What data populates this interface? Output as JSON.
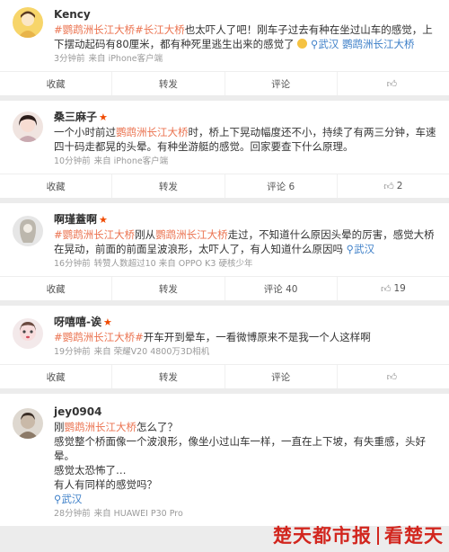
{
  "posts": [
    {
      "user": "Kency",
      "verified": false,
      "body_tags": [
        "#鹦鹉洲长江大桥",
        "#长江大桥"
      ],
      "body_text": "也太吓人了吧！刚车子过去有种在坐过山车的感觉，上下摆动起码有80厘米，都有种死里逃生出来的感觉了",
      "location": "武汉",
      "location_tag": "鹦鹉洲长江大桥",
      "time": "3分钟前",
      "source": "来自 iPhone客户端",
      "actions": {
        "fav": "收藏",
        "repost": "转发",
        "comment": "评论",
        "like": ""
      }
    },
    {
      "user": "桑三麻子",
      "verified": true,
      "body_pre": "一个小时前过",
      "body_tag": "鹦鹉洲长江大桥",
      "body_text": "时，桥上下晃动幅度还不小，持续了有两三分钟，车速四十码走都晃的头晕。有种坐游艇的感觉。回家要查下什么原理。",
      "time": "10分钟前",
      "source": "来自 iPhone客户端",
      "actions": {
        "fav": "收藏",
        "repost": "转发",
        "comment": "评论 6",
        "like": "2"
      }
    },
    {
      "user": "啊瑾蓋啊",
      "verified": true,
      "body_tag1": "#鹦鹉洲长江大桥",
      "body_mid": "刚从",
      "body_tag2": "鹦鹉洲长江大桥",
      "body_text": "走过，不知道什么原因头晕的厉害，感觉大桥在晃动，前面的前面呈波浪形，太吓人了，有人知道什么原因吗",
      "location": "武汉",
      "time": "16分钟前",
      "source": "转赞人数超过10  来自 OPPO K3 硬核少年",
      "actions": {
        "fav": "收藏",
        "repost": "转发",
        "comment": "评论 40",
        "like": "19"
      }
    },
    {
      "user": "呀嘻嘻-诶",
      "verified": true,
      "body_tag": "#鹦鹉洲长江大桥#",
      "body_text": "开车开到晕车，一看微博原来不是我一个人这样啊",
      "time": "19分钟前",
      "source": "来自 荣耀V20 4800万3D相机",
      "actions": {
        "fav": "收藏",
        "repost": "转发",
        "comment": "评论",
        "like": ""
      }
    },
    {
      "user": "jey0904",
      "verified": false,
      "line1_pre": "刚",
      "line1_tag": "鹦鹉洲长江大桥",
      "line1_post": "怎么了？",
      "line2": "感觉整个桥面像一个波浪形，像坐小过山车一样，一直在上下坡，有失重感，头好晕。",
      "line3": "感觉太恐怖了…",
      "line4": "有人有同样的感觉吗？",
      "location": "武汉",
      "time": "28分钟前",
      "source": "来自 HUAWEI P30 Pro"
    }
  ],
  "watermark": {
    "left": "楚天都市报",
    "right": "看楚天"
  },
  "colors": {
    "tag": "#eb7350",
    "link": "#3d7fc8",
    "verified": "#f04a00",
    "watermark": "#d2261e"
  }
}
